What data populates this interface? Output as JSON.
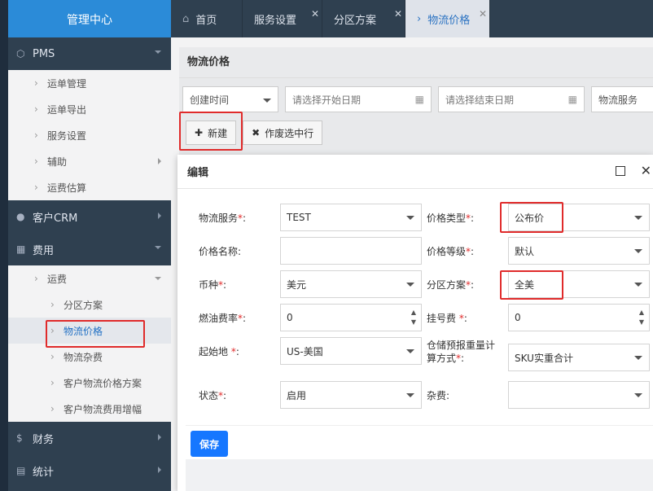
{
  "sidebar": {
    "brand": "管理中心",
    "groups": [
      {
        "label": "PMS",
        "icon": "cube-icon"
      },
      {
        "label": "客户CRM",
        "icon": "user-icon"
      },
      {
        "label": "费用",
        "icon": "grid-icon"
      },
      {
        "label": "财务",
        "icon": "dollar-icon"
      },
      {
        "label": "统计",
        "icon": "chart-icon"
      }
    ],
    "pms_items": [
      "运单管理",
      "运单导出",
      "服务设置",
      "辅助",
      "运费估算"
    ],
    "fee_items": {
      "parent": "运费",
      "children": [
        "分区方案",
        "物流价格",
        "物流杂费",
        "客户物流价格方案",
        "客户物流费用增幅"
      ]
    }
  },
  "tabs": [
    {
      "label": "首页"
    },
    {
      "label": "服务设置"
    },
    {
      "label": "分区方案"
    },
    {
      "label": "物流价格"
    }
  ],
  "page": {
    "title": "物流价格",
    "filters": {
      "time_select": "创建时间",
      "start_placeholder": "请选择开始日期",
      "end_placeholder": "请选择结束日期",
      "service_placeholder": "物流服务"
    },
    "buttons": {
      "new": "新建",
      "void": "作废选中行"
    }
  },
  "modal": {
    "title": "编辑",
    "fields": {
      "service_label": "物流服务",
      "service_value": "TEST",
      "price_type_label": "价格类型",
      "price_type_value": "公布价",
      "price_name_label": "价格名称:",
      "price_name_value": "",
      "price_level_label": "价格等级",
      "price_level_value": "默认",
      "currency_label": "币种",
      "currency_value": "美元",
      "zone_label": "分区方案",
      "zone_value": "全美",
      "fuel_label": "燃油费率",
      "fuel_value": "0",
      "reg_label": "挂号费 ",
      "reg_value": "0",
      "origin_label": "起始地 ",
      "origin_value": "US-美国",
      "calc_label_1": "仓储预报重量计",
      "calc_label_2": "算方式",
      "calc_value": "SKU实重合计",
      "status_label": "状态",
      "status_value": "启用",
      "misc_label": "杂费:",
      "misc_value": ""
    },
    "save": "保存"
  }
}
